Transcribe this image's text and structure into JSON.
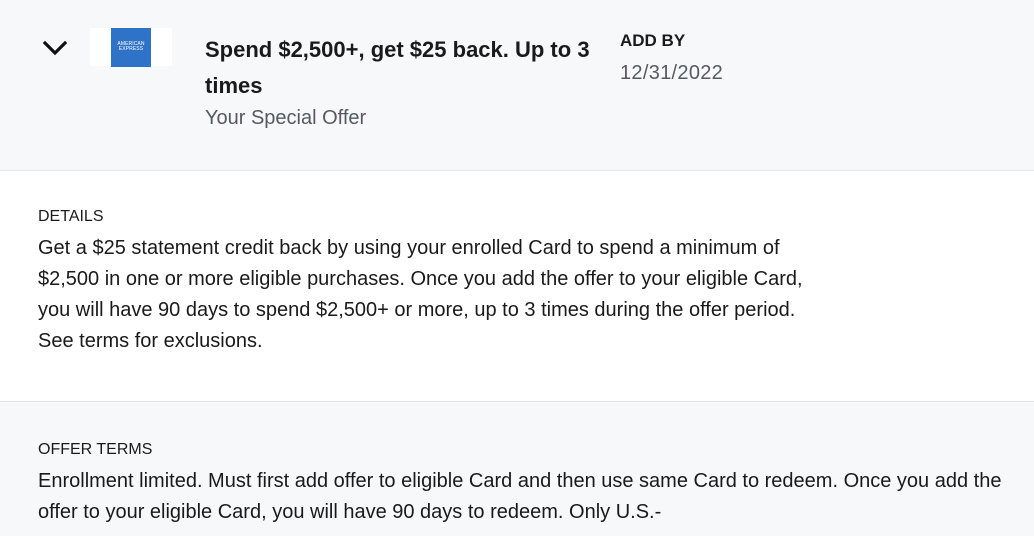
{
  "offer": {
    "toggle_icon": "chevron-down-icon",
    "logo": {
      "line1": "AMERICAN",
      "line2": "EXPRESS",
      "bg_color": "#2f73c8"
    },
    "title": "Spend $2,500+, get $25 back. Up to 3 times",
    "subtitle": "Your Special Offer",
    "add_by_label": "ADD BY",
    "add_by_date": "12/31/2022"
  },
  "details": {
    "label": "DETAILS",
    "text": "Get a $25 statement credit back by using your enrolled Card to spend a minimum of $2,500 in one or more eligible purchases. Once you add the offer to your eligible Card, you will have 90 days to spend $2,500+ or more, up to 3 times during the offer period. See terms for exclusions."
  },
  "terms": {
    "label": "OFFER TERMS",
    "text": "Enrollment limited. Must first add offer to eligible Card and then use same Card to redeem. Once you add the offer to your eligible Card, you will have 90 days to redeem. Only U.S.-"
  }
}
